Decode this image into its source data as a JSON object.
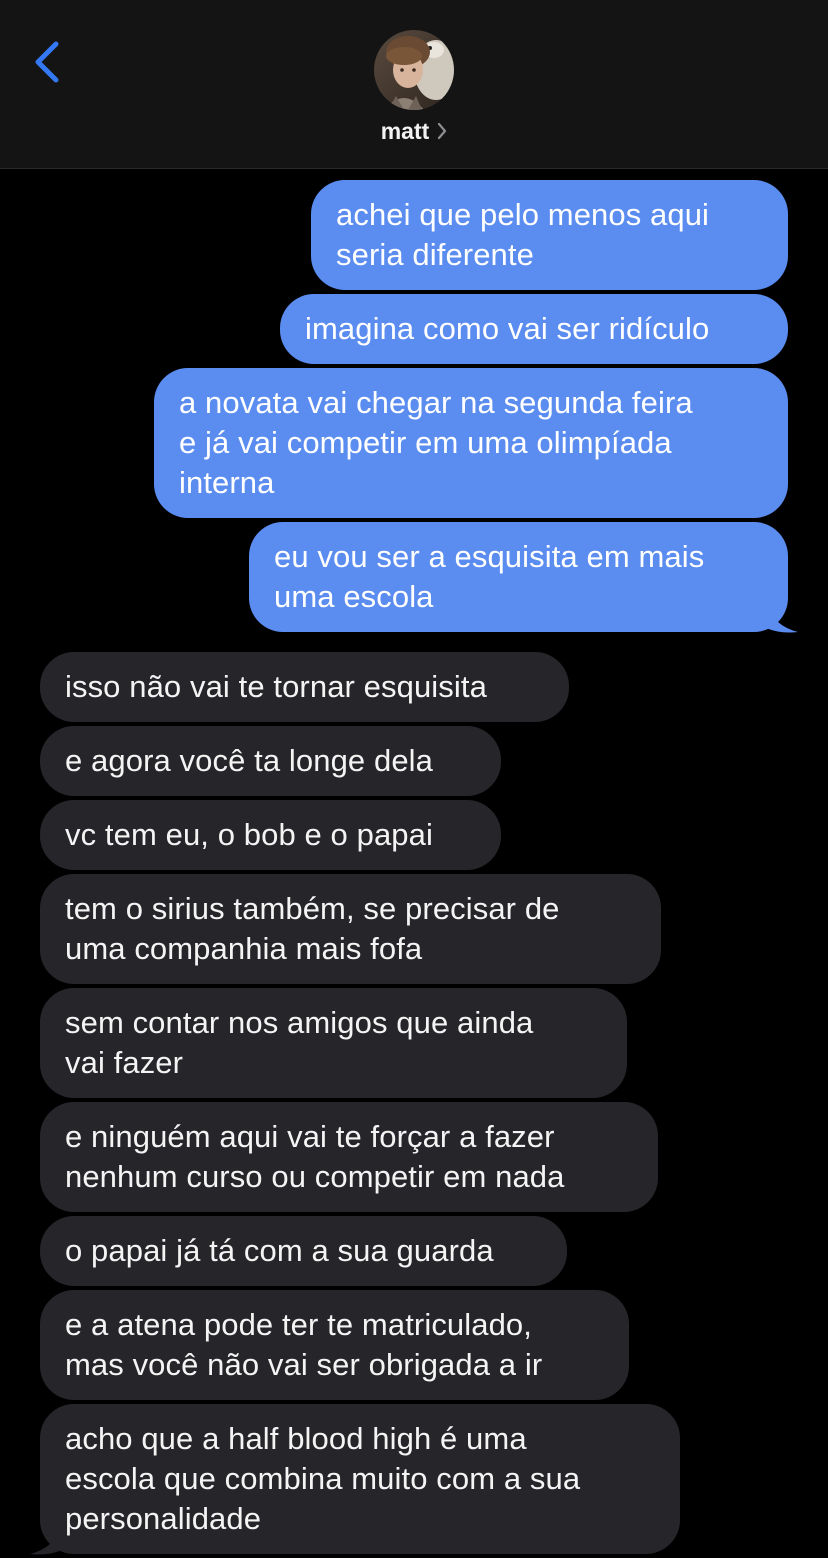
{
  "header": {
    "contact_name": "matt",
    "back_icon": "chevron-left-icon",
    "details_icon": "chevron-right-icon",
    "accent_color": "#3478f6"
  },
  "colors": {
    "sent_bubble": "#5b8cf0",
    "received_bubble": "#26262a",
    "background": "#000000"
  },
  "messages": [
    {
      "from": "me",
      "text": "achei que pelo menos aqui\nseria diferente"
    },
    {
      "from": "me",
      "text": "imagina como vai ser ridículo"
    },
    {
      "from": "me",
      "text": "a novata vai chegar na segunda feira\ne já vai competir em uma olimpíada\ninterna"
    },
    {
      "from": "me",
      "text": "eu vou ser a esquisita em mais\numa escola"
    },
    {
      "from": "them",
      "text": "isso não vai te tornar esquisita"
    },
    {
      "from": "them",
      "text": "e agora você ta longe dela"
    },
    {
      "from": "them",
      "text": "vc tem eu, o bob e o papai"
    },
    {
      "from": "them",
      "text": "tem o sirius também, se precisar de\numa companhia mais fofa"
    },
    {
      "from": "them",
      "text": "sem contar nos amigos que ainda\nvai fazer"
    },
    {
      "from": "them",
      "text": "e ninguém aqui vai te forçar a fazer\nnenhum curso ou competir em nada"
    },
    {
      "from": "them",
      "text": "o papai já tá com a sua guarda"
    },
    {
      "from": "them",
      "text": "e a atena pode ter te matriculado,\nmas você não vai ser obrigada a ir"
    },
    {
      "from": "them",
      "text": "acho que a half blood high é uma\nescola que combina muito com a sua\npersonalidade"
    }
  ]
}
